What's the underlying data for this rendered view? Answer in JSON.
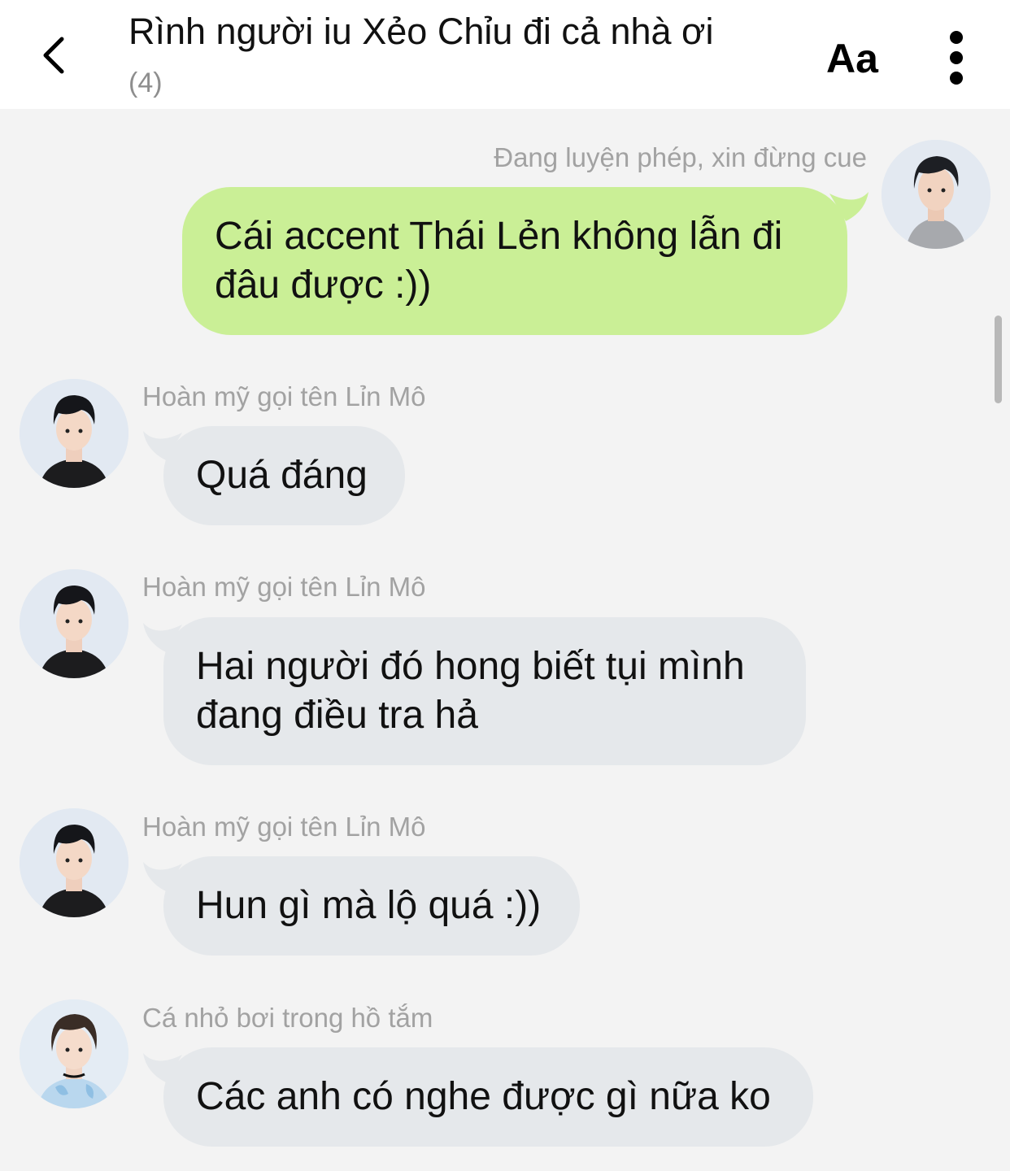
{
  "header": {
    "title": "Rình người iu Xẻo Chỉu đi cả nhà ơi",
    "member_count": "(4)",
    "font_button": "Aa"
  },
  "messages": [
    {
      "direction": "outgoing",
      "sender": "Đang luyện phép, xin đừng cue",
      "text": "Cái accent Thái Lẻn không lẫn đi đâu được :))"
    },
    {
      "direction": "incoming",
      "sender": "Hoàn mỹ gọi tên Lỉn Mô",
      "text": "Quá đáng"
    },
    {
      "direction": "incoming",
      "sender": "Hoàn mỹ gọi tên Lỉn Mô",
      "text": "Hai người đó hong biết tụi mình đang điều tra hả"
    },
    {
      "direction": "incoming",
      "sender": "Hoàn mỹ gọi tên Lỉn Mô",
      "text": "Hun gì mà lộ quá :))"
    },
    {
      "direction": "incoming",
      "sender": "Cá nhỏ bơi trong hồ tắm",
      "text": "Các anh có nghe được gì nữa ko"
    }
  ],
  "colors": {
    "outgoing_bubble": "#caef96",
    "incoming_bubble": "#e5e8eb",
    "background": "#f3f3f3"
  }
}
